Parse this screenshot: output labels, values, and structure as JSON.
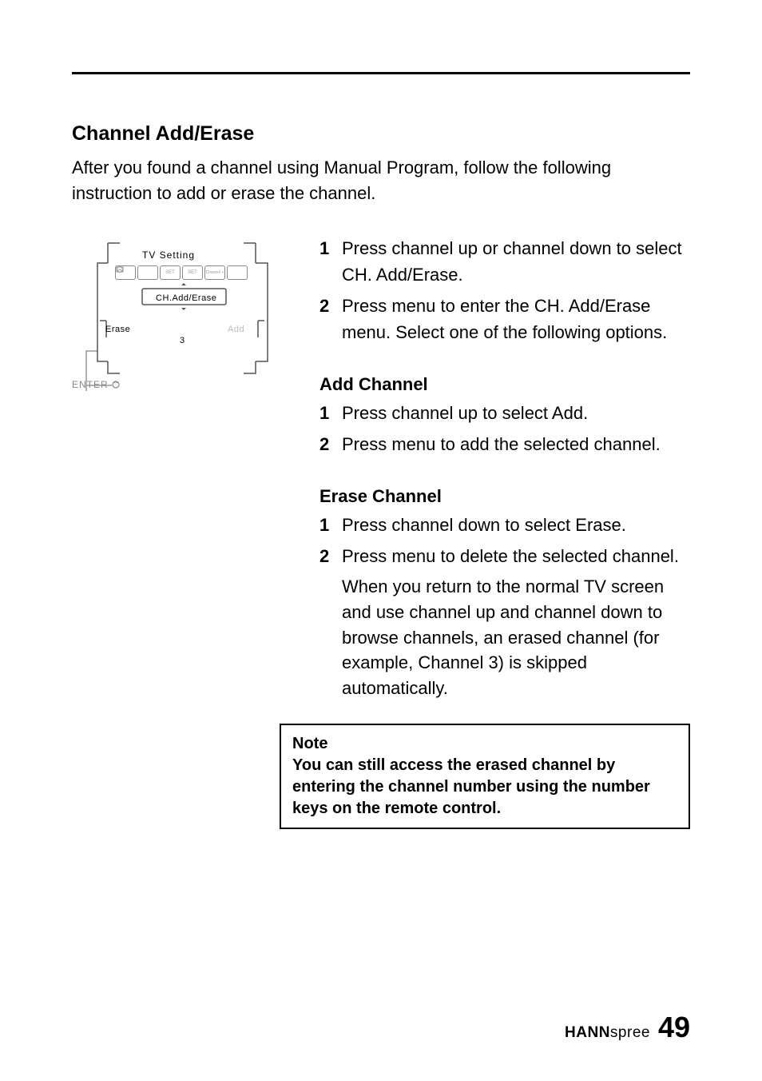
{
  "heading": "Channel Add/Erase",
  "intro": "After you found a channel using Manual Program, follow the following instruction to add or erase the channel.",
  "diagram": {
    "title": "TV    Setting",
    "option": "CH.Add/Erase",
    "leftAction": "Erase",
    "rightAction": "Add",
    "number": "3",
    "enter": "ENTER",
    "iconLabels": [
      "",
      "",
      "SET",
      "SET",
      "Channel +",
      ""
    ]
  },
  "mainList": [
    {
      "n": "1",
      "text": "Press channel up or channel down to select CH. Add/Erase."
    },
    {
      "n": "2",
      "text": "Press menu to enter the CH. Add/Erase menu. Select one of the following options."
    }
  ],
  "addChannel": {
    "title": "Add Channel",
    "items": [
      {
        "n": "1",
        "text": "Press channel up to select Add."
      },
      {
        "n": "2",
        "text": "Press menu to add the selected channel."
      }
    ]
  },
  "eraseChannel": {
    "title": "Erase Channel",
    "items": [
      {
        "n": "1",
        "text": "Press channel down to select Erase."
      },
      {
        "n": "2",
        "text": "Press menu to delete the selected channel."
      }
    ],
    "continuation": "When you return to the normal TV screen and use channel up and channel down to browse channels, an erased channel (for example, Channel 3) is skipped automatically."
  },
  "note": {
    "title": "Note",
    "body": "You can still access the erased channel by entering the channel number using the number keys on the remote control."
  },
  "footer": {
    "brandBold": "HANN",
    "brandLight": "spree",
    "page": "49"
  }
}
